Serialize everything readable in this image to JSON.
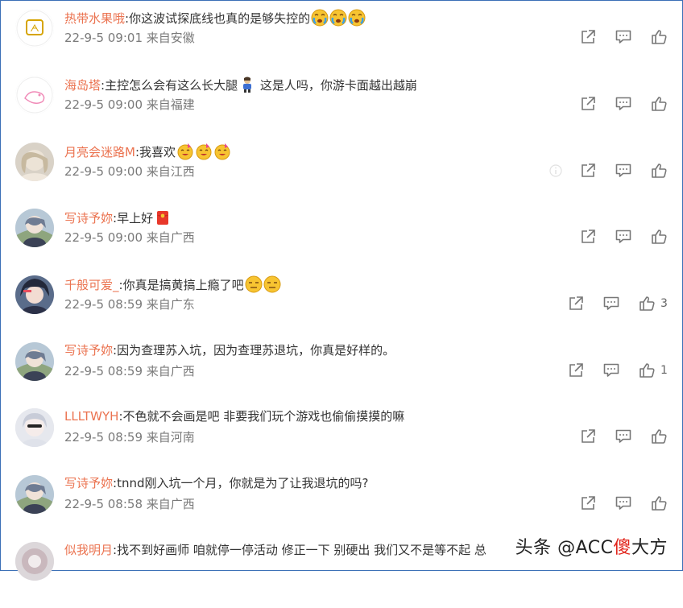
{
  "comments": [
    {
      "user": "热带水果哦",
      "text": ":你这波试探底线也真的是够失控的",
      "time": "22-9-5 09:01",
      "loc": "来自安徽",
      "likes": "",
      "emoji": [
        "tear-face",
        "tear-face",
        "tear-face"
      ]
    },
    {
      "user": "海岛塔",
      "text": ":主控怎么会有这么长大腿",
      "text2": " 这是人吗，你游卡面越出越崩",
      "time": "22-9-5 09:00",
      "loc": "来自福建",
      "likes": "",
      "emoji": [
        "figure"
      ]
    },
    {
      "user": "月亮会迷路M",
      "text": ":我喜欢",
      "time": "22-9-5 09:00",
      "loc": "来自江西",
      "likes": "",
      "emoji": [
        "party-face",
        "party-face",
        "party-face"
      ]
    },
    {
      "user": "写诗予妳",
      "text": ":早上好",
      "time": "22-9-5 09:00",
      "loc": "来自广西",
      "likes": "",
      "emoji": [
        "red-envelope"
      ]
    },
    {
      "user": "千般可爱_",
      "text": ":你真是搞黄搞上瘾了吧",
      "time": "22-9-5 08:59",
      "loc": "来自广东",
      "likes": "3",
      "emoji": [
        "smirk-face",
        "smirk-face"
      ]
    },
    {
      "user": "写诗予妳",
      "text": ":因为查理苏入坑，因为查理苏退坑，你真是好样的。",
      "time": "22-9-5 08:59",
      "loc": "来自广西",
      "likes": "1",
      "emoji": []
    },
    {
      "user": "LLLTWYH",
      "text": ":不色就不会画是吧   非要我们玩个游戏也偷偷摸摸的嘛",
      "time": "22-9-5 08:59",
      "loc": "来自河南",
      "likes": "",
      "emoji": []
    },
    {
      "user": "写诗予妳",
      "text": ":tnnd刚入坑一个月，你就是为了让我退坑的吗?",
      "time": "22-9-5 08:58",
      "loc": "来自广西",
      "likes": "",
      "emoji": []
    },
    {
      "user": "似我明月",
      "text": ":找不到好画师 咱就停一停活动 修正一下 别硬出 我们又不是等不起 总",
      "time": "",
      "loc": "",
      "likes": "",
      "emoji": []
    }
  ],
  "watermark": {
    "prefix": "头条 @ACC",
    "red": "傻",
    "suffix": "大方"
  },
  "icons": {
    "share": "share-icon",
    "comment": "comment-icon",
    "like": "like-icon"
  }
}
